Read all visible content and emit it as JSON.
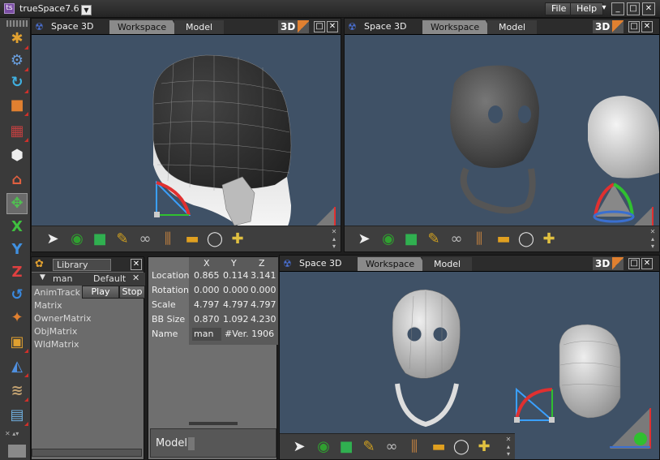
{
  "app": {
    "title": "trueSpace7.6",
    "icon": "ts-logo-icon"
  },
  "menu": {
    "file": "File",
    "help": "Help"
  },
  "window_controls": {
    "dropdown": "▾",
    "minimize": "_",
    "maximize": "□",
    "close": "✕"
  },
  "viewports": [
    {
      "label": "Space 3D",
      "tab_workspace": "Workspace",
      "tab_model": "Model",
      "mode": "3D"
    },
    {
      "label": "Space 3D",
      "tab_workspace": "Workspace",
      "tab_model": "Model",
      "mode": "3D"
    },
    {
      "label": "Space 3D",
      "tab_workspace": "Workspace",
      "tab_model": "Model",
      "mode": "3D"
    }
  ],
  "library": {
    "tab": "Library",
    "object": "man",
    "preset": "Default",
    "anim_track": "AnimTrack",
    "play": "Play",
    "stop": "Stop",
    "items": [
      "Matrix",
      "OwnerMatrix",
      "ObjMatrix",
      "WldMatrix"
    ]
  },
  "properties": {
    "columns": [
      "X",
      "Y",
      "Z"
    ],
    "rows": [
      {
        "label": "Location",
        "values": [
          "0.865",
          "0.114",
          "3.141"
        ]
      },
      {
        "label": "Rotation",
        "values": [
          "0.000",
          "0.000",
          "0.000"
        ]
      },
      {
        "label": "Scale",
        "values": [
          "4.797",
          "4.797",
          "4.797"
        ]
      },
      {
        "label": "BB Size",
        "values": [
          "0.870",
          "1.092",
          "4.230"
        ]
      }
    ],
    "name_label": "Name",
    "name_value": "man",
    "version": "#Ver. 1906",
    "model_label": "Model"
  },
  "colors": {
    "viewport_bg": "#3f5166",
    "panel_bg": "#6b6b6b",
    "accent_orange": "#e08030"
  }
}
